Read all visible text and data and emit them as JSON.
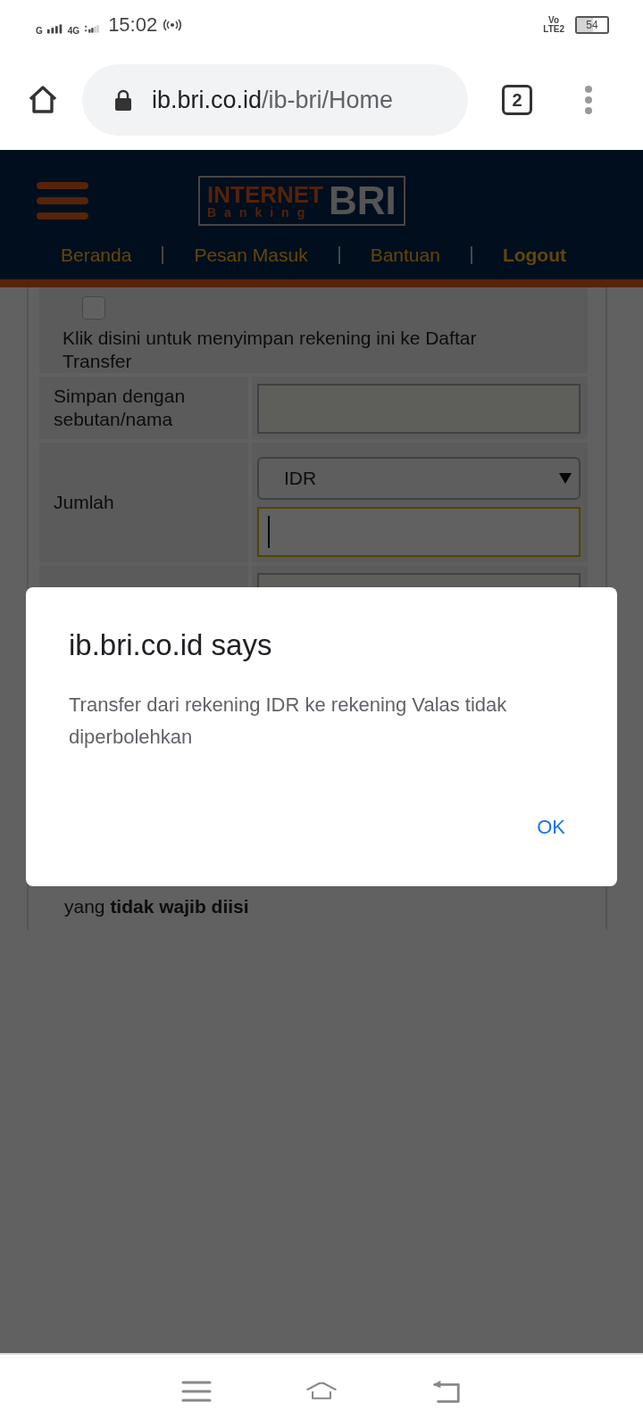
{
  "status_bar": {
    "network_1": "G",
    "network_2": "4G",
    "time": "15:02",
    "volte": "Vo",
    "lte": "LTE2",
    "battery": "54"
  },
  "browser": {
    "url_host": "ib.bri.co.id",
    "url_path": "/ib-bri/Home",
    "tab_count": "2"
  },
  "site_header": {
    "logo": {
      "line_1": "INTERNET",
      "line_2": "Banking",
      "brand": "BRI"
    },
    "nav": [
      {
        "label": "Beranda",
        "emphasized": false
      },
      {
        "label": "Pesan Masuk",
        "emphasized": false
      },
      {
        "label": "Bantuan",
        "emphasized": false
      },
      {
        "label": "Logout",
        "emphasized": true
      }
    ]
  },
  "form": {
    "save_checkbox": {
      "checked": false,
      "label": "Klik disini untuk menyimpan rekening ini ke Daftar Transfer"
    },
    "rows": [
      {
        "label": "Simpan dengan sebutan/nama",
        "fields": [
          {
            "kind": "text",
            "focused": false
          }
        ]
      },
      {
        "label": "Jumlah",
        "fields": [
          {
            "kind": "select",
            "value": "IDR"
          },
          {
            "kind": "text",
            "focused": true
          }
        ]
      },
      {
        "fields": [
          {
            "kind": "text",
            "focused": false
          }
        ]
      }
    ],
    "note": "yang **tidak wajib diisi**"
  },
  "dialog": {
    "title": "ib.bri.co.id says",
    "message": "Transfer dari rekening IDR ke rekening Valas tidak diperbolehkan",
    "buttons": [
      "OK"
    ]
  }
}
